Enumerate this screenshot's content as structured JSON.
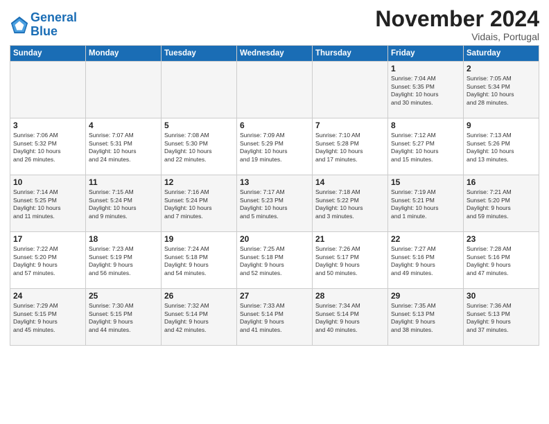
{
  "header": {
    "logo_line1": "General",
    "logo_line2": "Blue",
    "month": "November 2024",
    "location": "Vidais, Portugal"
  },
  "weekdays": [
    "Sunday",
    "Monday",
    "Tuesday",
    "Wednesday",
    "Thursday",
    "Friday",
    "Saturday"
  ],
  "weeks": [
    [
      {
        "day": "",
        "info": ""
      },
      {
        "day": "",
        "info": ""
      },
      {
        "day": "",
        "info": ""
      },
      {
        "day": "",
        "info": ""
      },
      {
        "day": "",
        "info": ""
      },
      {
        "day": "1",
        "info": "Sunrise: 7:04 AM\nSunset: 5:35 PM\nDaylight: 10 hours\nand 30 minutes."
      },
      {
        "day": "2",
        "info": "Sunrise: 7:05 AM\nSunset: 5:34 PM\nDaylight: 10 hours\nand 28 minutes."
      }
    ],
    [
      {
        "day": "3",
        "info": "Sunrise: 7:06 AM\nSunset: 5:32 PM\nDaylight: 10 hours\nand 26 minutes."
      },
      {
        "day": "4",
        "info": "Sunrise: 7:07 AM\nSunset: 5:31 PM\nDaylight: 10 hours\nand 24 minutes."
      },
      {
        "day": "5",
        "info": "Sunrise: 7:08 AM\nSunset: 5:30 PM\nDaylight: 10 hours\nand 22 minutes."
      },
      {
        "day": "6",
        "info": "Sunrise: 7:09 AM\nSunset: 5:29 PM\nDaylight: 10 hours\nand 19 minutes."
      },
      {
        "day": "7",
        "info": "Sunrise: 7:10 AM\nSunset: 5:28 PM\nDaylight: 10 hours\nand 17 minutes."
      },
      {
        "day": "8",
        "info": "Sunrise: 7:12 AM\nSunset: 5:27 PM\nDaylight: 10 hours\nand 15 minutes."
      },
      {
        "day": "9",
        "info": "Sunrise: 7:13 AM\nSunset: 5:26 PM\nDaylight: 10 hours\nand 13 minutes."
      }
    ],
    [
      {
        "day": "10",
        "info": "Sunrise: 7:14 AM\nSunset: 5:25 PM\nDaylight: 10 hours\nand 11 minutes."
      },
      {
        "day": "11",
        "info": "Sunrise: 7:15 AM\nSunset: 5:24 PM\nDaylight: 10 hours\nand 9 minutes."
      },
      {
        "day": "12",
        "info": "Sunrise: 7:16 AM\nSunset: 5:24 PM\nDaylight: 10 hours\nand 7 minutes."
      },
      {
        "day": "13",
        "info": "Sunrise: 7:17 AM\nSunset: 5:23 PM\nDaylight: 10 hours\nand 5 minutes."
      },
      {
        "day": "14",
        "info": "Sunrise: 7:18 AM\nSunset: 5:22 PM\nDaylight: 10 hours\nand 3 minutes."
      },
      {
        "day": "15",
        "info": "Sunrise: 7:19 AM\nSunset: 5:21 PM\nDaylight: 10 hours\nand 1 minute."
      },
      {
        "day": "16",
        "info": "Sunrise: 7:21 AM\nSunset: 5:20 PM\nDaylight: 9 hours\nand 59 minutes."
      }
    ],
    [
      {
        "day": "17",
        "info": "Sunrise: 7:22 AM\nSunset: 5:20 PM\nDaylight: 9 hours\nand 57 minutes."
      },
      {
        "day": "18",
        "info": "Sunrise: 7:23 AM\nSunset: 5:19 PM\nDaylight: 9 hours\nand 56 minutes."
      },
      {
        "day": "19",
        "info": "Sunrise: 7:24 AM\nSunset: 5:18 PM\nDaylight: 9 hours\nand 54 minutes."
      },
      {
        "day": "20",
        "info": "Sunrise: 7:25 AM\nSunset: 5:18 PM\nDaylight: 9 hours\nand 52 minutes."
      },
      {
        "day": "21",
        "info": "Sunrise: 7:26 AM\nSunset: 5:17 PM\nDaylight: 9 hours\nand 50 minutes."
      },
      {
        "day": "22",
        "info": "Sunrise: 7:27 AM\nSunset: 5:16 PM\nDaylight: 9 hours\nand 49 minutes."
      },
      {
        "day": "23",
        "info": "Sunrise: 7:28 AM\nSunset: 5:16 PM\nDaylight: 9 hours\nand 47 minutes."
      }
    ],
    [
      {
        "day": "24",
        "info": "Sunrise: 7:29 AM\nSunset: 5:15 PM\nDaylight: 9 hours\nand 45 minutes."
      },
      {
        "day": "25",
        "info": "Sunrise: 7:30 AM\nSunset: 5:15 PM\nDaylight: 9 hours\nand 44 minutes."
      },
      {
        "day": "26",
        "info": "Sunrise: 7:32 AM\nSunset: 5:14 PM\nDaylight: 9 hours\nand 42 minutes."
      },
      {
        "day": "27",
        "info": "Sunrise: 7:33 AM\nSunset: 5:14 PM\nDaylight: 9 hours\nand 41 minutes."
      },
      {
        "day": "28",
        "info": "Sunrise: 7:34 AM\nSunset: 5:14 PM\nDaylight: 9 hours\nand 40 minutes."
      },
      {
        "day": "29",
        "info": "Sunrise: 7:35 AM\nSunset: 5:13 PM\nDaylight: 9 hours\nand 38 minutes."
      },
      {
        "day": "30",
        "info": "Sunrise: 7:36 AM\nSunset: 5:13 PM\nDaylight: 9 hours\nand 37 minutes."
      }
    ]
  ]
}
